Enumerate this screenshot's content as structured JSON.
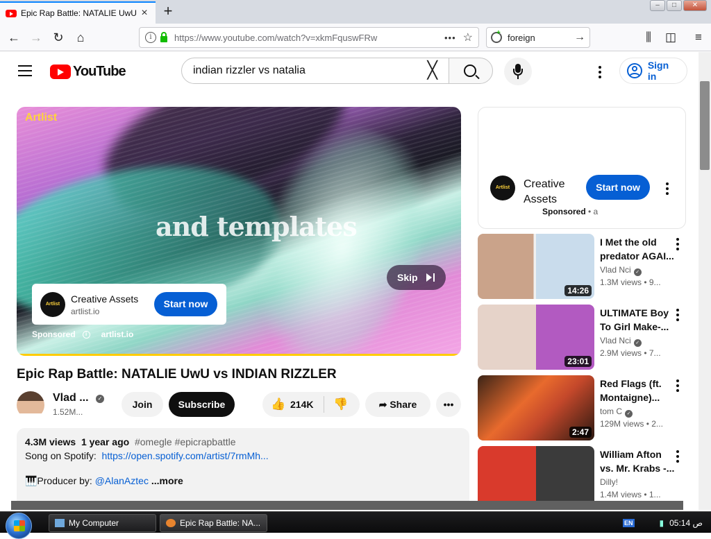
{
  "browser": {
    "tab_title": "Epic Rap Battle: NATALIE UwU vs INDIAN RIZZLER",
    "url": "https://www.youtube.com/watch?v=xkmFquswFRw",
    "search_value": "foreign"
  },
  "yt": {
    "logo_text": "YouTube",
    "search_query": "indian rizzler vs natalia",
    "sign_in": "Sign in"
  },
  "player": {
    "brand": "Artlist",
    "overlay_text": "and templates",
    "skip_label": "Skip",
    "ad_name": "Creative Assets",
    "ad_domain": "artlist.io",
    "start_now": "Start now",
    "sponsored": "Sponsored",
    "sponsored_domain": "artlist.io",
    "avatar_text": "Artlist"
  },
  "video": {
    "title": "Epic Rap Battle: NATALIE UwU vs INDIAN RIZZLER",
    "channel": "Vlad ...",
    "subscribers": "1.52M...",
    "join": "Join",
    "subscribe": "Subscribe",
    "likes": "214K",
    "share": "Share"
  },
  "description": {
    "views": "4.3M views",
    "age": "1 year ago",
    "tags": "#omegle #epicrapbattle",
    "spotify_label": "Song on Spotify:",
    "spotify_link": "https://open.spotify.com/artist/7rmMh...",
    "producer_label": "🎹Producer by:",
    "producer_link": "@AlanAztec",
    "more": "...more"
  },
  "side_ad": {
    "name": "Creative Assets",
    "sponsored": "Sponsored",
    "sponsored_suffix": " • a",
    "start_now": "Start now",
    "avatar_text": "Artlist"
  },
  "recommendations": [
    {
      "title": "I Met the old predator AGAI...",
      "channel": "Vlad Nci",
      "verified": true,
      "meta": "1.3M views • 9...",
      "duration": "14:26"
    },
    {
      "title": "ULTIMATE Boy To Girl Make-...",
      "channel": "Vlad Nci",
      "verified": true,
      "meta": "2.9M views • 7...",
      "duration": "23:01"
    },
    {
      "title": "Red Flags (ft. Montaigne)...",
      "channel": "tom C",
      "verified": true,
      "meta": "129M views • 2...",
      "duration": "2:47"
    },
    {
      "title": "William Afton vs. Mr. Krabs -...",
      "channel": "Dilly!",
      "verified": false,
      "meta": "1.4M views • 1...",
      "duration": ""
    }
  ],
  "taskbar": {
    "task1": "My Computer",
    "task2": "Epic Rap Battle: NA...",
    "lang": "EN",
    "clock": "05:14 ص"
  }
}
